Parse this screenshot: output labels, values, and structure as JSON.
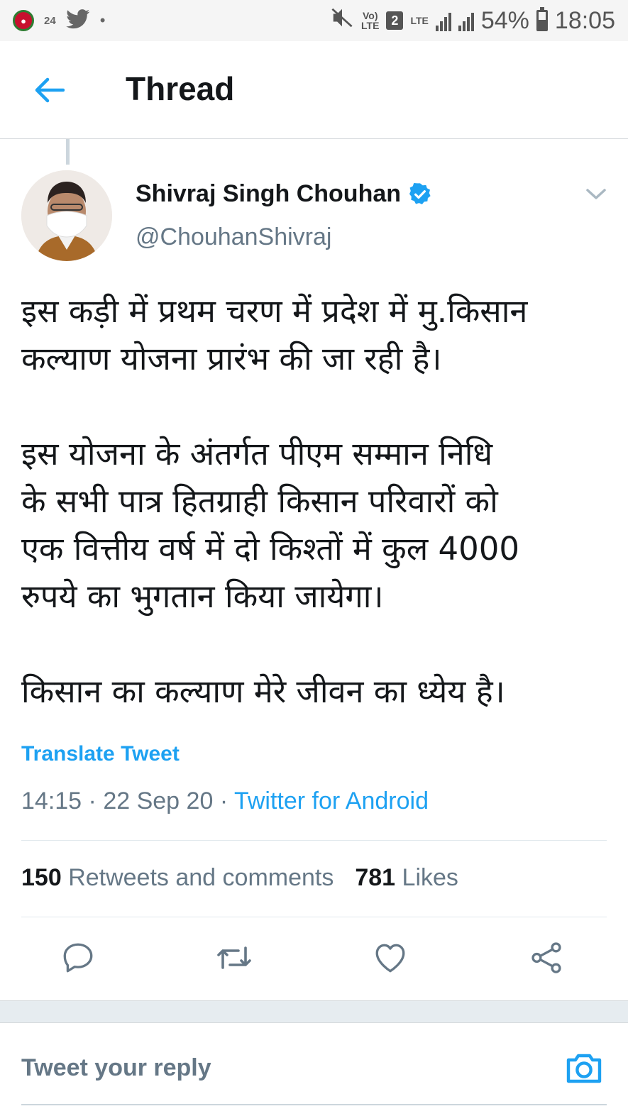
{
  "status_bar": {
    "notification_count": "24",
    "network_volte": "Vo)\nLTE",
    "sim_slot": "2",
    "network_type": "LTE",
    "battery": "54%",
    "time": "18:05"
  },
  "header": {
    "title": "Thread",
    "back_icon": "arrow-left-icon"
  },
  "tweet": {
    "author_name": "Shivraj Singh Chouhan",
    "handle": "@ChouhanShivraj",
    "verified": true,
    "paragraphs": [
      [
        "इस कड़ी में प्रथम चरण में प्रदेश में मु.किसान",
        "कल्याण योजना प्रारंभ की जा रही है।"
      ],
      [
        "इस योजना के अंतर्गत पीएम सम्मान निधि",
        "के सभी पात्र हितग्राही किसान परिवारों को",
        "एक वित्तीय वर्ष में दो किश्तों में कुल 4000",
        "रुपये का भुगतान किया जायेगा।"
      ],
      [
        "किसान का कल्याण मेरे जीवन का ध्येय है।"
      ]
    ],
    "translate_label": "Translate Tweet",
    "time": "14:15",
    "date": "22 Sep 20",
    "source": "Twitter for Android",
    "retweets_count": "150",
    "retweets_label": "Retweets and comments",
    "likes_count": "781",
    "likes_label": "Likes"
  },
  "actions": [
    "reply-icon",
    "retweet-icon",
    "like-icon",
    "share-icon"
  ],
  "reply": {
    "placeholder": "Tweet your reply"
  },
  "colors": {
    "accent": "#1da1f2",
    "text": "#14171a",
    "secondary": "#657786"
  }
}
